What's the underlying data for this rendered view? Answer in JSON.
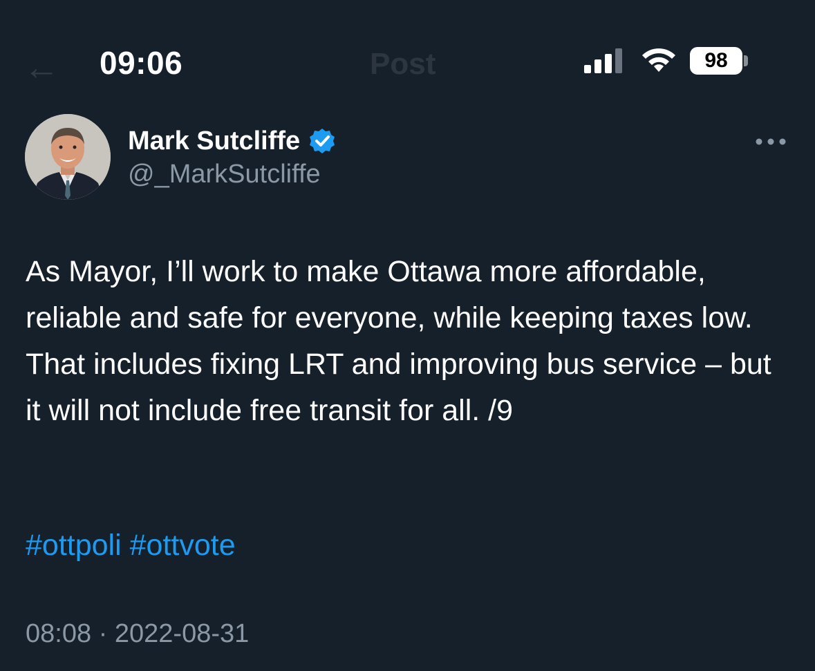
{
  "status_bar": {
    "time": "09:06",
    "battery_level": "98",
    "icons": [
      "signal-icon",
      "wifi-icon",
      "battery-icon"
    ]
  },
  "nav": {
    "title": "Post",
    "back_icon": "back-arrow-icon"
  },
  "author": {
    "display_name": "Mark Sutcliffe",
    "handle": "@_MarkSutcliffe",
    "verified": true,
    "verified_color": "#1d9bf0"
  },
  "tweet": {
    "text": "As Mayor, I’ll work to make Ottawa more affordable, reliable and safe for everyone, while keeping taxes low. That includes fixing LRT and improving bus service – but it will not include free transit for all. /9",
    "hashtags": [
      "#ottpoli",
      "#ottvote"
    ],
    "time": "08:08",
    "separator": "·",
    "date": "2022-08-31"
  },
  "colors": {
    "background": "#16202b",
    "text": "#ffffff",
    "secondary_text": "#8b98a5",
    "link": "#1d9bf0"
  }
}
